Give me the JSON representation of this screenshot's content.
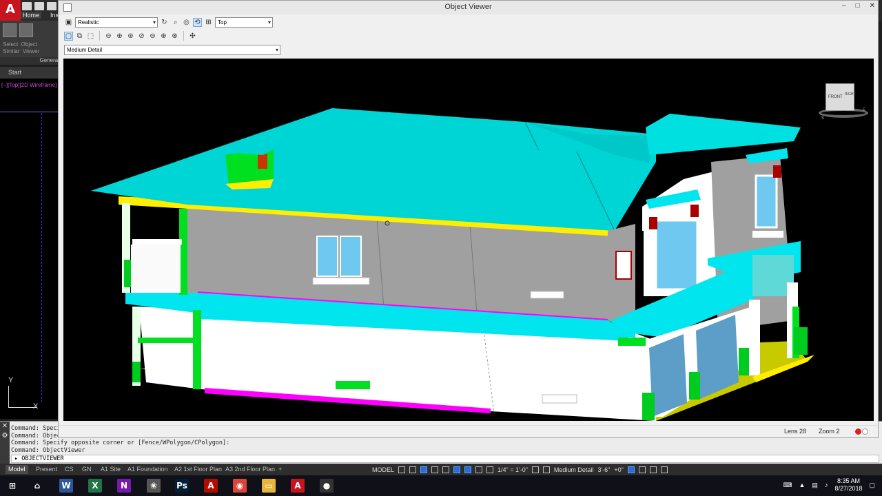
{
  "autocad": {
    "logo_letter": "A",
    "ribbon_tabs": [
      "Home",
      "Inse"
    ],
    "ribbon_labels": "Select  Object\nSimilar  Viewer",
    "panel_label": "General",
    "file_tab": "Start",
    "viewport_label": "[−][Top][2D Wireframe]",
    "ucs_y": "Y",
    "ucs_x": "X",
    "command_history": [
      "Command: Specify",
      "Command: Object",
      "Command: Specify opposite corner or [Fence/WPolygon/CPolygon]:",
      "Command: ObjectViewer"
    ],
    "command_prompt": "OBJECTVIEWER",
    "layout_tabs": [
      "Model",
      "Present",
      "CS",
      "GN",
      "A1 Site",
      "A1 Foundation",
      "A2 1st Floor Plan",
      "A3 2nd Floor Plan",
      "+"
    ],
    "status_model": "MODEL",
    "status_scale": "1/4\" = 1'-0\"",
    "status_detail": "Medium Detail",
    "status_elev": "3'-6\"",
    "status_plus": "+0\""
  },
  "taskbar": {
    "apps": [
      {
        "name": "windows-start",
        "glyph": "⊞",
        "color": "#101018"
      },
      {
        "name": "home",
        "glyph": "⌂",
        "color": "#101018"
      },
      {
        "name": "word",
        "glyph": "W",
        "color": "#2b579a"
      },
      {
        "name": "excel",
        "glyph": "X",
        "color": "#217346"
      },
      {
        "name": "onenote",
        "glyph": "N",
        "color": "#7719aa"
      },
      {
        "name": "paint",
        "glyph": "❀",
        "color": "#555"
      },
      {
        "name": "photoshop",
        "glyph": "Ps",
        "color": "#001e36"
      },
      {
        "name": "acrobat",
        "glyph": "A",
        "color": "#b30b00"
      },
      {
        "name": "chrome",
        "glyph": "◉",
        "color": "#db4437"
      },
      {
        "name": "file-explorer",
        "glyph": "▭",
        "color": "#e8b53a"
      },
      {
        "name": "autocad",
        "glyph": "A",
        "color": "#c8141e"
      },
      {
        "name": "obs",
        "glyph": "●",
        "color": "#333"
      }
    ],
    "time": "8:35 AM",
    "date": "8/27/2018"
  },
  "viewer": {
    "title": "Object Viewer",
    "visual_style": "Realistic",
    "view": "Top",
    "detail": "Medium Detail",
    "lens": "Lens 28",
    "zoom": "Zoom 2",
    "viewcube_front": "FRONT",
    "viewcube_right": "RIGHT",
    "compass_s": "S",
    "compass_e": "E",
    "minimize": "–",
    "maximize": "□",
    "close": "✕"
  }
}
